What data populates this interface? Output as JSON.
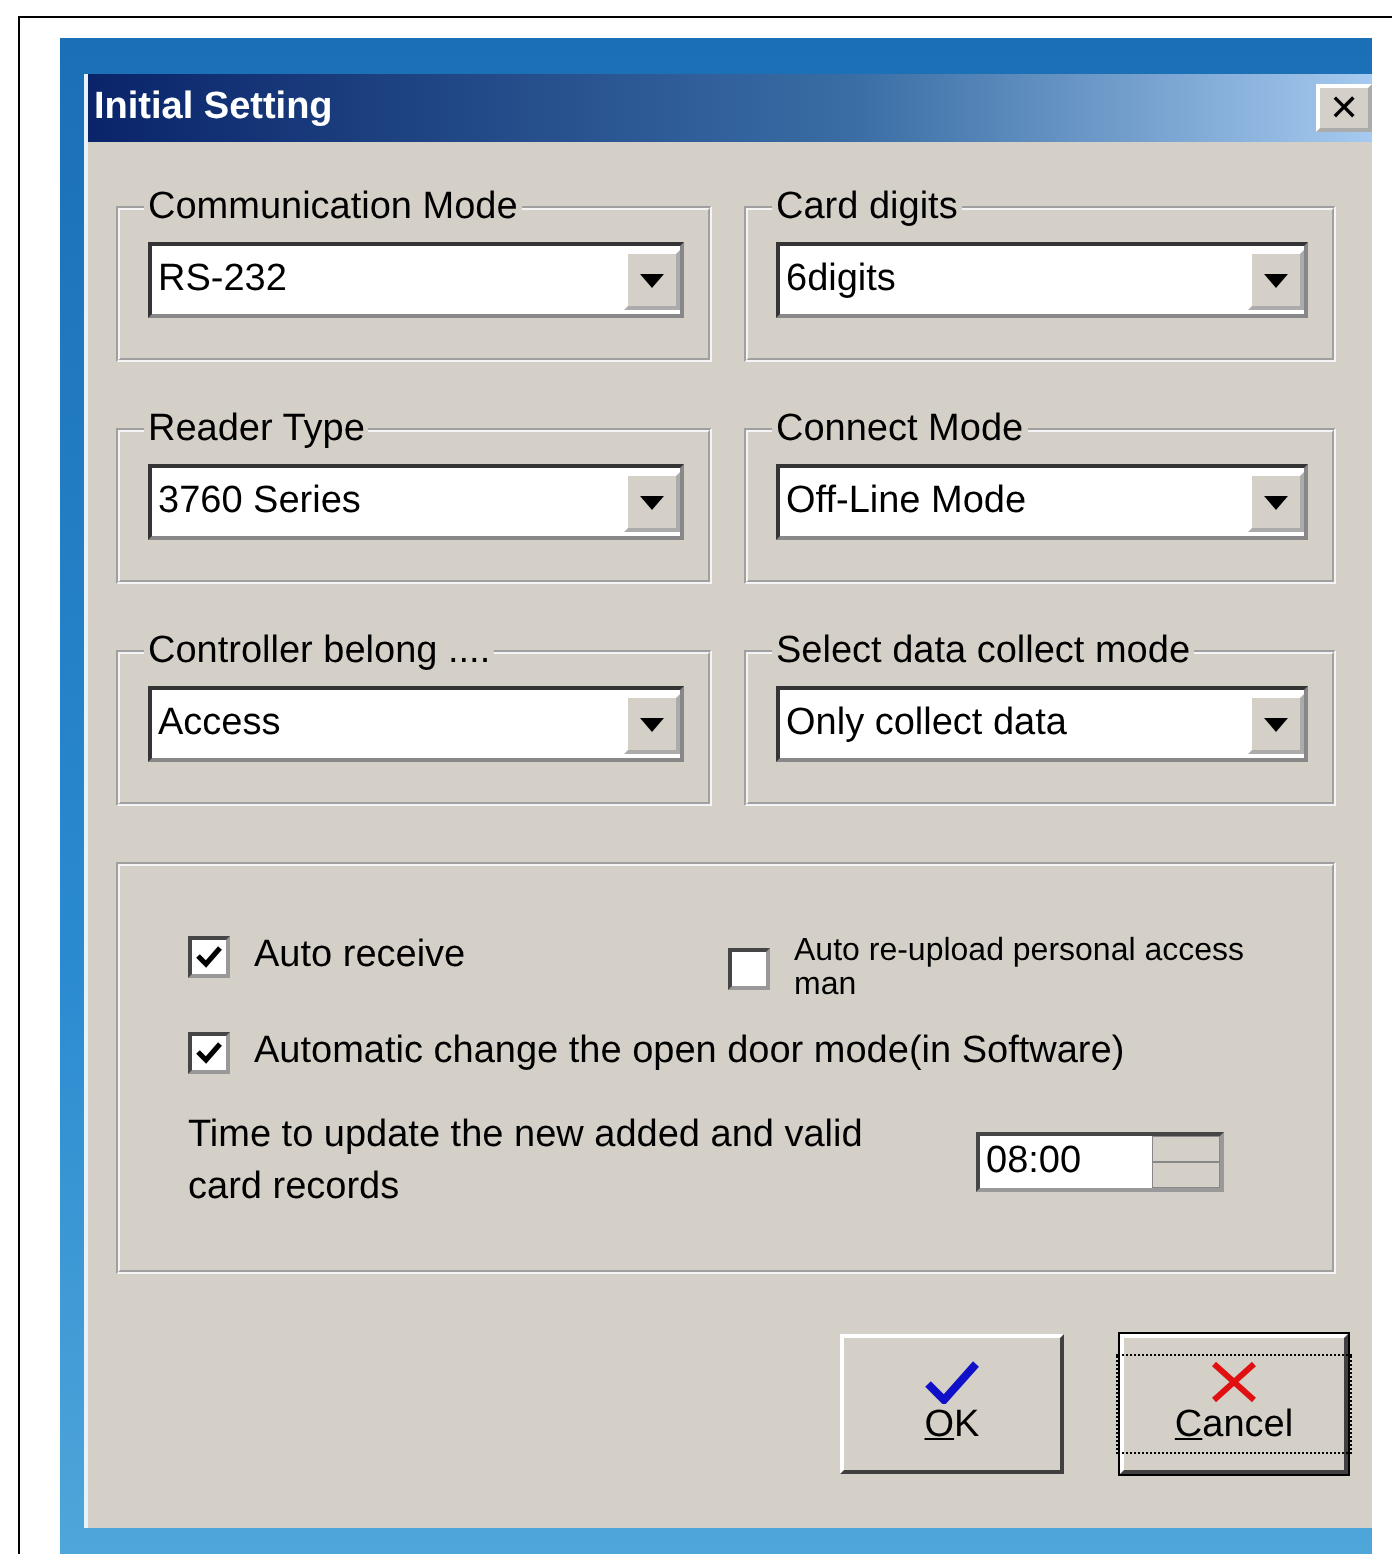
{
  "window": {
    "title": "Initial Setting",
    "close": "✕"
  },
  "groups": [
    {
      "label": "Communication Mode",
      "value": "RS-232"
    },
    {
      "label": "Card digits",
      "value": "6digits"
    },
    {
      "label": "Reader Type",
      "value": "3760 Series"
    },
    {
      "label": "Connect Mode",
      "value": "Off-Line Mode"
    },
    {
      "label": "Controller belong ....",
      "value": "Access"
    },
    {
      "label": "Select data collect mode",
      "value": "Only collect data"
    }
  ],
  "options": {
    "checkboxes": [
      {
        "label": "Auto receive",
        "checked": true
      },
      {
        "label": "Auto re-upload personal access man",
        "checked": false
      },
      {
        "label": "Automatic change the open door mode(in Software)",
        "checked": true
      }
    ],
    "time_label": "Time to update the new added and valid card records",
    "time_value": "08:00"
  },
  "buttons": [
    {
      "label": "OK",
      "kind": "ok",
      "first_letter_underlined": true,
      "focused": false
    },
    {
      "label": "Cancel",
      "kind": "cancel",
      "first_letter_underlined": true,
      "focused": true
    }
  ]
}
